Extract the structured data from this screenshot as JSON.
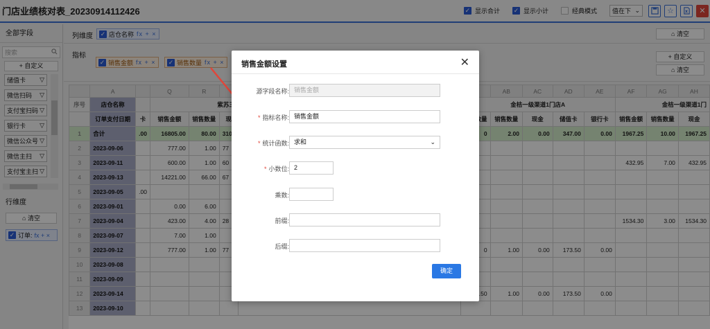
{
  "title": "门店业绩核对表_20230914112426",
  "toolbar": {
    "show_total": "显示合计",
    "show_subtotal": "显示小计",
    "classic_mode": "经典模式",
    "value_position": "值在下"
  },
  "left_panel": {
    "all_fields": "全部字段",
    "search_placeholder": "搜索",
    "custom": "+ 自定义",
    "fields": [
      "储值卡",
      "微信扫码",
      "支付宝扫码",
      "银行卡",
      "微信公众号",
      "微信主扫",
      "支付宝主扫"
    ],
    "row_dimension": "行维度",
    "clear": "清空",
    "row_tag": "订单:"
  },
  "column_dimension": {
    "label": "列维度",
    "tag": "店仓名称",
    "tag_ops": "fx + ×",
    "clear": "清空"
  },
  "metrics": {
    "label": "指标",
    "tags": [
      "销售金额",
      "销售数量"
    ],
    "tag_ops": "fx + ×",
    "custom": "+ 自定义",
    "clear": "清空"
  },
  "table": {
    "letters": [
      "A",
      "",
      "Q",
      "R",
      "",
      "",
      "",
      "",
      "",
      "",
      "",
      "",
      "",
      "",
      "",
      "AB",
      "AC",
      "AD",
      "AE",
      "AF",
      "AG",
      "AH"
    ],
    "row_no_label": "序号",
    "store_label": "店仓名称",
    "date_label": "订单支付日期",
    "group1": "紫苏三",
    "group2": "金桔一级渠道1门店A",
    "group3": "金桔一级渠道1门",
    "col_sales_amount": "销售金额",
    "col_sales_qty": "销售数量",
    "col_cash": "现金",
    "col_stored": "储值卡",
    "col_bank": "银行卡",
    "col_partial": "卡",
    "col_cash_partial": "现",
    "rows": [
      {
        "n": "1",
        "date": "合计",
        "p": ".00",
        "q": "16805.00",
        "r": "80.00",
        "s": "310",
        "ab_l": "0",
        "ab": "2.00",
        "ac": "0.00",
        "ad": "347.00",
        "ae": "0.00",
        "af": "1967.25",
        "ag": "10.00",
        "ah": "1967.25"
      },
      {
        "n": "2",
        "date": "2023-09-06",
        "p": "",
        "q": "777.00",
        "r": "1.00",
        "s": "77",
        "ab_l": "",
        "ab": "",
        "ac": "",
        "ad": "",
        "ae": "",
        "af": "",
        "ag": "",
        "ah": ""
      },
      {
        "n": "3",
        "date": "2023-09-11",
        "p": "",
        "q": "600.00",
        "r": "1.00",
        "s": "60",
        "ab_l": "",
        "ab": "",
        "ac": "",
        "ad": "",
        "ae": "",
        "af": "432.95",
        "ag": "7.00",
        "ah": "432.95"
      },
      {
        "n": "4",
        "date": "2023-09-13",
        "p": "",
        "q": "14221.00",
        "r": "66.00",
        "s": "67",
        "ab_l": "",
        "ab": "",
        "ac": "",
        "ad": "",
        "ae": "",
        "af": "",
        "ag": "",
        "ah": ""
      },
      {
        "n": "5",
        "date": "2023-09-05",
        "p": ".00",
        "q": "",
        "r": "",
        "s": "",
        "ab_l": "",
        "ab": "",
        "ac": "",
        "ad": "",
        "ae": "",
        "af": "",
        "ag": "",
        "ah": ""
      },
      {
        "n": "6",
        "date": "2023-09-01",
        "p": "",
        "q": "0.00",
        "r": "6.00",
        "s": "",
        "ab_l": "",
        "ab": "",
        "ac": "",
        "ad": "",
        "ae": "",
        "af": "",
        "ag": "",
        "ah": ""
      },
      {
        "n": "7",
        "date": "2023-09-04",
        "p": "",
        "q": "423.00",
        "r": "4.00",
        "s": "28",
        "ab_l": "",
        "ab": "",
        "ac": "",
        "ad": "",
        "ae": "",
        "af": "1534.30",
        "ag": "3.00",
        "ah": "1534.30"
      },
      {
        "n": "8",
        "date": "2023-09-07",
        "p": "",
        "q": "7.00",
        "r": "1.00",
        "s": "",
        "ab_l": "",
        "ab": "",
        "ac": "",
        "ad": "",
        "ae": "",
        "af": "",
        "ag": "",
        "ah": ""
      },
      {
        "n": "9",
        "date": "2023-09-12",
        "p": "",
        "q": "777.00",
        "r": "1.00",
        "s": "77",
        "ab_l": "0",
        "ab": "1.00",
        "ac": "0.00",
        "ad": "173.50",
        "ae": "0.00",
        "af": "",
        "ag": "",
        "ah": ""
      },
      {
        "n": "10",
        "date": "2023-09-08",
        "p": "",
        "q": "",
        "r": "",
        "s": "",
        "ab_l": "",
        "ab": "",
        "ac": "",
        "ad": "",
        "ae": "",
        "af": "",
        "ag": "",
        "ah": ""
      },
      {
        "n": "11",
        "date": "2023-09-09",
        "p": "",
        "q": "",
        "r": "",
        "s": "",
        "ab_l": "",
        "ab": "",
        "ac": "",
        "ad": "",
        "ae": "",
        "af": "",
        "ag": "",
        "ah": ""
      },
      {
        "n": "12",
        "date": "2023-09-14",
        "p": "",
        "q": "",
        "r": "",
        "s": "",
        "ab_l": "173.50",
        "ab": "1.00",
        "ac": "0.00",
        "ad": "173.50",
        "ae": "0.00",
        "af": "",
        "ag": "",
        "ah": ""
      },
      {
        "n": "13",
        "date": "2023-09-10",
        "p": "",
        "q": "",
        "r": "",
        "s": "",
        "ab_l": "",
        "ab": "",
        "ac": "",
        "ad": "",
        "ae": "",
        "af": "",
        "ag": "",
        "ah": ""
      }
    ]
  },
  "modal": {
    "title": "销售金额设置",
    "source_label": "源字段名称:",
    "source_value": "销售金额",
    "name_label": "指标名称:",
    "name_value": "销售金额",
    "func_label": "统计函数:",
    "func_value": "求和",
    "decimal_label": "小数位:",
    "decimal_value": "2",
    "multiplier_label": "乘数:",
    "prefix_label": "前缀:",
    "suffix_label": "后缀:",
    "ok": "确定"
  },
  "colors": {
    "accent": "#2a78e4",
    "arrow": "#e0463a",
    "total_row": "#d6efcc",
    "date_col": "#a9aec8"
  }
}
